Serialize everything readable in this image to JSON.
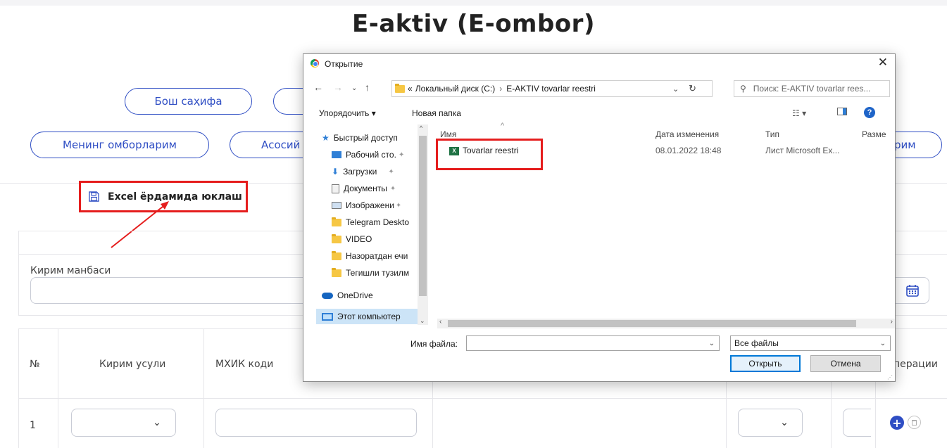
{
  "page": {
    "title": "E-aktiv (E-ombor)",
    "nav_row1": [
      "Бош саҳифа"
    ],
    "nav_row2": [
      "Менинг омборларим",
      "Асосий",
      "рим"
    ],
    "excel_button": "Excel ёрдамида юклаш",
    "source_label": "Кирим манбаси",
    "table_headers": {
      "num": "№",
      "method": "Кирим усули",
      "code": "МХИК коди",
      "ops": "Операции"
    },
    "row_number": "1"
  },
  "dialog": {
    "title": "Открытие",
    "breadcrumb_prefix": "«",
    "breadcrumb": [
      "Локальный диск (C:)",
      "E-AKTIV tovarlar reestri"
    ],
    "search_placeholder": "Поиск: E-AKTIV tovarlar rees...",
    "toolbar": {
      "organize": "Упорядочить ▾",
      "new_folder": "Новая папка"
    },
    "nav_items": [
      {
        "label": "Быстрый доступ",
        "icon": "star-icon"
      },
      {
        "label": "Рабочий сто.",
        "icon": "desktop-icon"
      },
      {
        "label": "Загрузки",
        "icon": "download-icon"
      },
      {
        "label": "Документы",
        "icon": "documents-icon"
      },
      {
        "label": "Изображени",
        "icon": "pictures-icon"
      },
      {
        "label": "Telegram Deskto",
        "icon": "folder-icon"
      },
      {
        "label": "VIDEO",
        "icon": "folder-icon"
      },
      {
        "label": "Назоратдан ечи",
        "icon": "folder-icon"
      },
      {
        "label": "Тегишли тузилм",
        "icon": "folder-icon"
      },
      {
        "label": "OneDrive",
        "icon": "cloud-icon"
      },
      {
        "label": "Этот компьютер",
        "icon": "computer-icon"
      }
    ],
    "columns": [
      "Имя",
      "Дата изменения",
      "Тип",
      "Разме"
    ],
    "files": [
      {
        "name": "Tovarlar reestri",
        "date": "08.01.2022 18:48",
        "type": "Лист Microsoft Ex...",
        "icon": "excel-icon"
      }
    ],
    "filename_label": "Имя файла:",
    "filename_value": "",
    "filter_value": "Все файлы",
    "open_button": "Открыть",
    "cancel_button": "Отмена"
  },
  "colors": {
    "accent": "#2f4ec4",
    "highlight": "#e51d1d",
    "plus": "#2f4ec4"
  }
}
